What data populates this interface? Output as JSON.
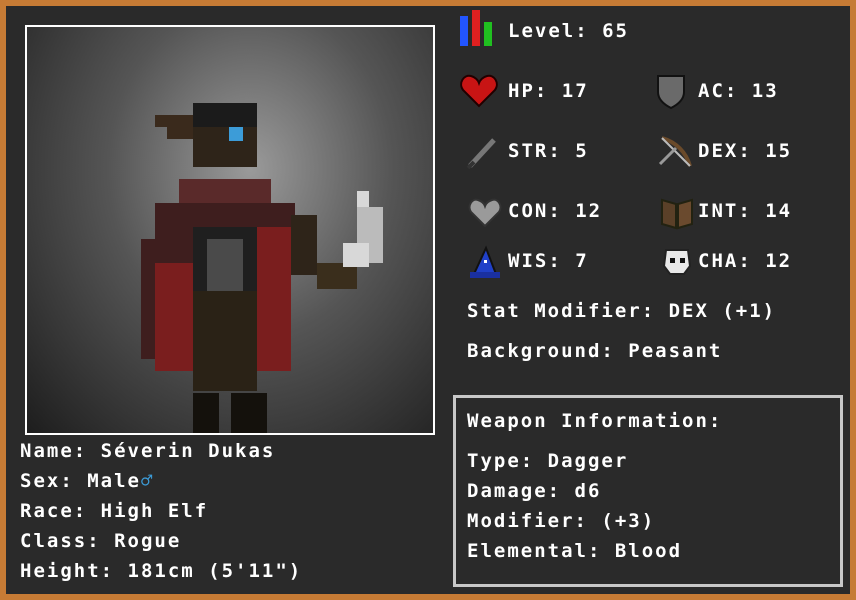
{
  "character": {
    "name_label": "Name:",
    "name": "Séverin Dukas",
    "sex_label": "Sex:",
    "sex": "Male",
    "sex_symbol": "♂",
    "race_label": "Race:",
    "race": "High Elf",
    "class_label": "Class:",
    "class": "Rogue",
    "height_label": "Height:",
    "height": "181cm (5'11\")"
  },
  "stats": {
    "level": "Level: 65",
    "hp": "HP: 17",
    "ac": "AC: 13",
    "str": "STR: 5",
    "dex": "DEX: 15",
    "con": "CON: 12",
    "int": "INT: 14",
    "wis": "WIS: 7",
    "cha": "CHA: 12",
    "stat_modifier": "Stat Modifier: DEX (+1)",
    "background": "Background: Peasant"
  },
  "weapon": {
    "title": "Weapon Information:",
    "type": "Type: Dagger",
    "damage": "Damage: d6",
    "modifier": "Modifier: (+3)",
    "elemental": "Elemental: Blood"
  },
  "colors": {
    "border": "#c67b35",
    "background": "#2a2a2a",
    "male_symbol": "#3c9cd8"
  }
}
